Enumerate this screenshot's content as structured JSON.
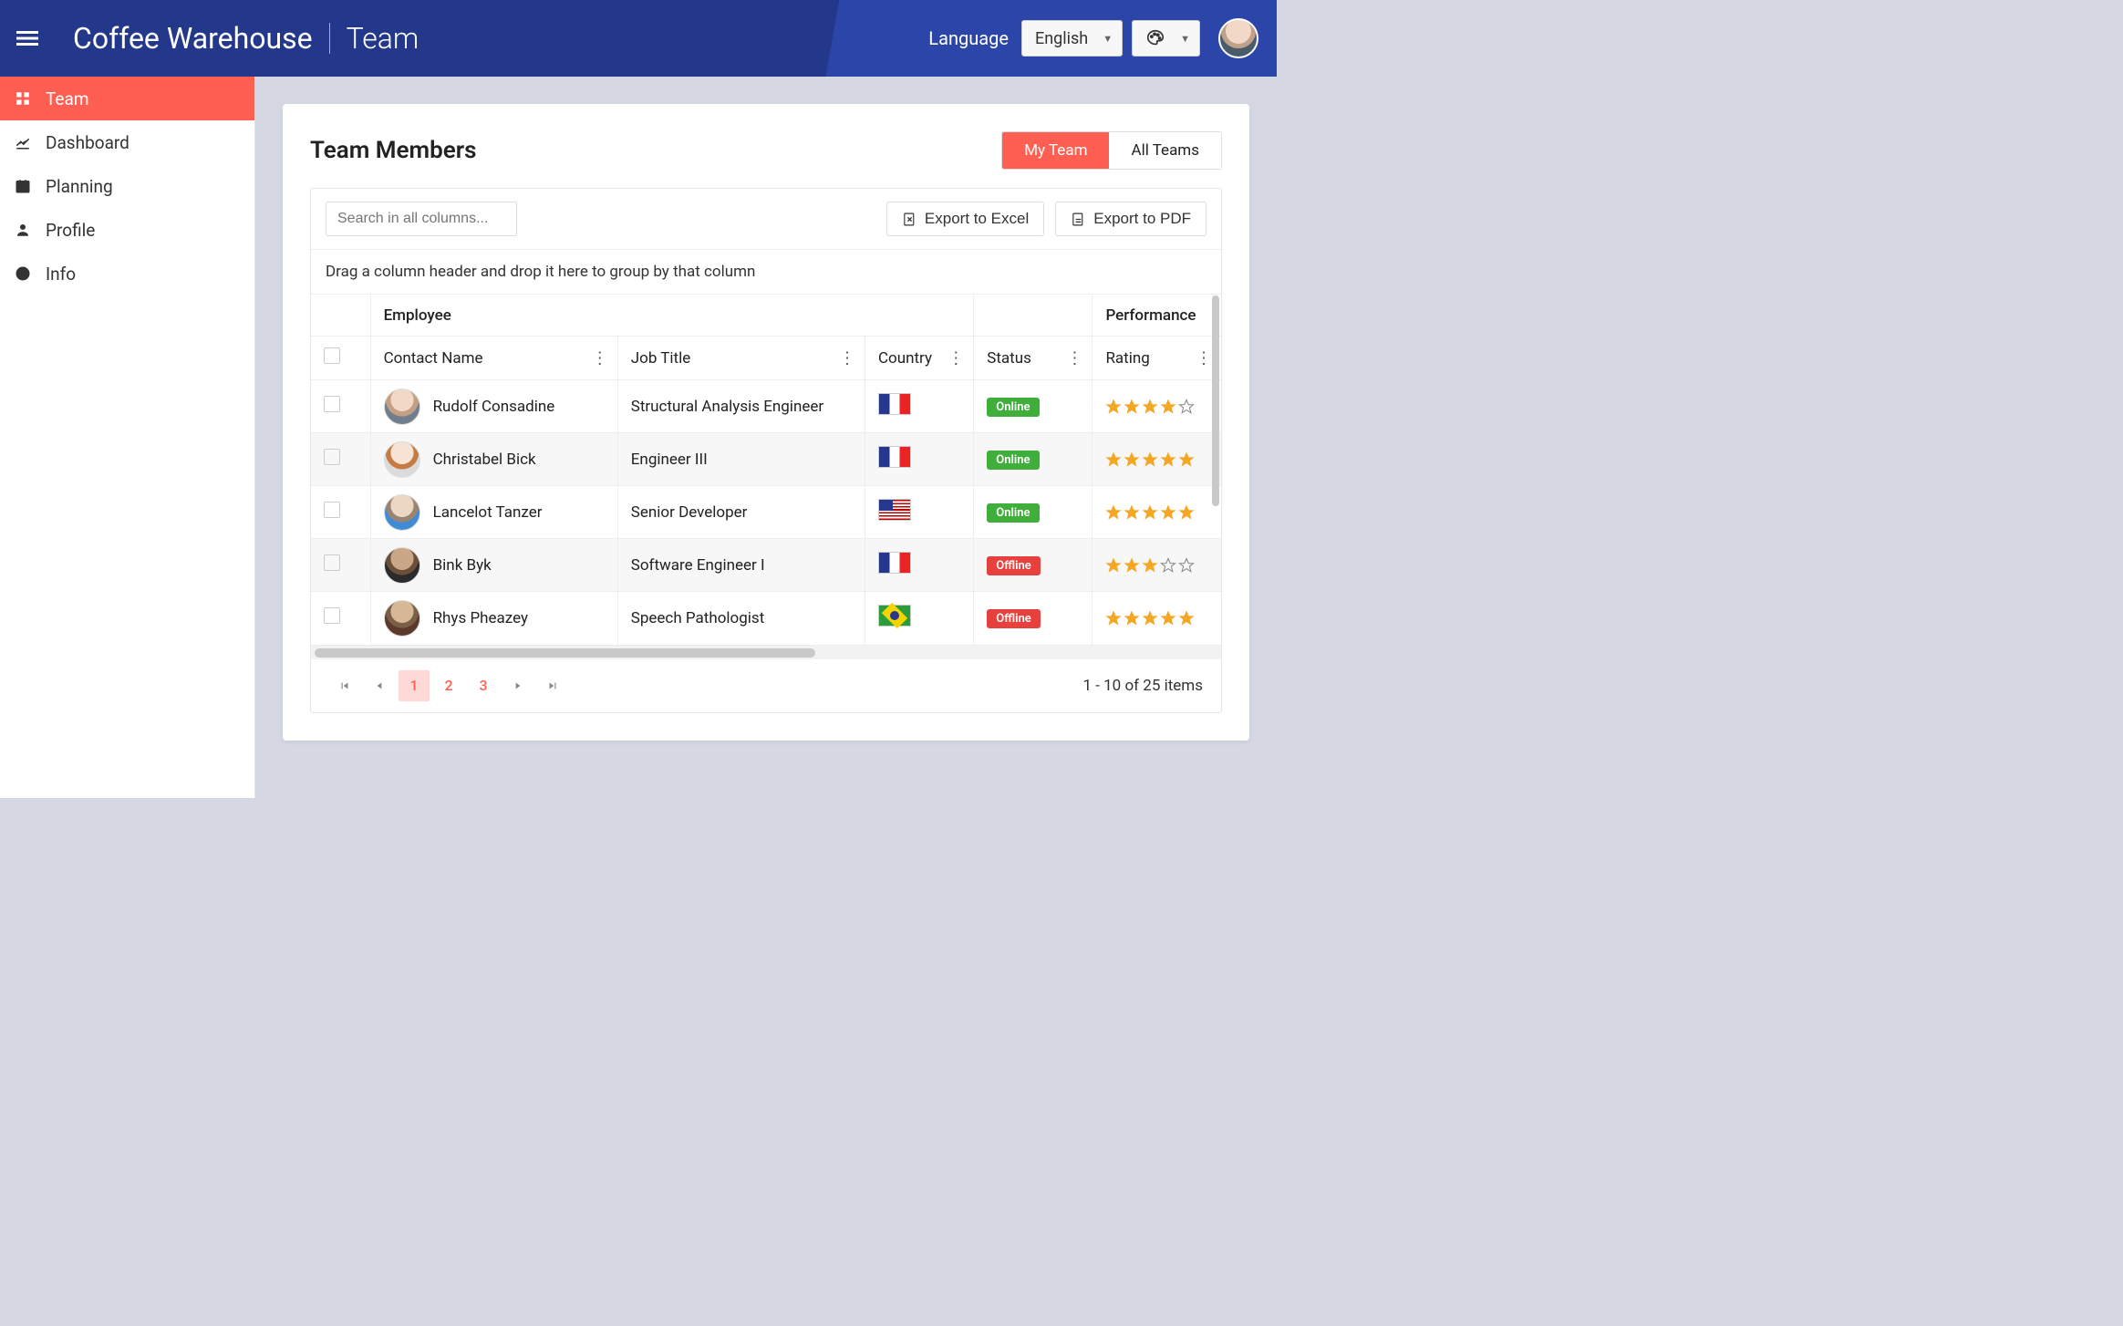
{
  "header": {
    "app_title": "Coffee Warehouse",
    "breadcrumb": "Team",
    "language_label": "Language",
    "language_value": "English"
  },
  "sidebar": {
    "items": [
      {
        "label": "Team",
        "icon": "grid-icon",
        "active": true
      },
      {
        "label": "Dashboard",
        "icon": "chart-icon",
        "active": false
      },
      {
        "label": "Planning",
        "icon": "calendar-icon",
        "active": false
      },
      {
        "label": "Profile",
        "icon": "user-icon",
        "active": false
      },
      {
        "label": "Info",
        "icon": "info-icon",
        "active": false
      }
    ]
  },
  "page": {
    "title": "Team Members",
    "tabs": [
      {
        "label": "My Team",
        "active": true
      },
      {
        "label": "All Teams",
        "active": false
      }
    ],
    "search_placeholder": "Search in all columns...",
    "export_excel": "Export to Excel",
    "export_pdf": "Export to PDF",
    "group_hint": "Drag a column header and drop it here to group by that column"
  },
  "grid": {
    "group_headers": {
      "employee": "Employee",
      "performance": "Performance"
    },
    "columns": {
      "contact": "Contact Name",
      "job": "Job Title",
      "country": "Country",
      "status": "Status",
      "rating": "Rating"
    },
    "status_labels": {
      "online": "Online",
      "offline": "Offline"
    },
    "rows": [
      {
        "name": "Rudolf Consadine",
        "job": "Structural Analysis Engineer",
        "country": "fr",
        "status": "online",
        "rating": 4,
        "avatar": "a1"
      },
      {
        "name": "Christabel Bick",
        "job": "Engineer III",
        "country": "fr",
        "status": "online",
        "rating": 5,
        "avatar": "a2"
      },
      {
        "name": "Lancelot Tanzer",
        "job": "Senior Developer",
        "country": "us",
        "status": "online",
        "rating": 5,
        "avatar": "a3"
      },
      {
        "name": "Bink Byk",
        "job": "Software Engineer I",
        "country": "fr",
        "status": "offline",
        "rating": 3,
        "avatar": "a4"
      },
      {
        "name": "Rhys Pheazey",
        "job": "Speech Pathologist",
        "country": "br",
        "status": "offline",
        "rating": 5,
        "avatar": "a5"
      }
    ]
  },
  "pager": {
    "pages": [
      "1",
      "2",
      "3"
    ],
    "active_page": "1",
    "info": "1 - 10 of 25 items"
  }
}
